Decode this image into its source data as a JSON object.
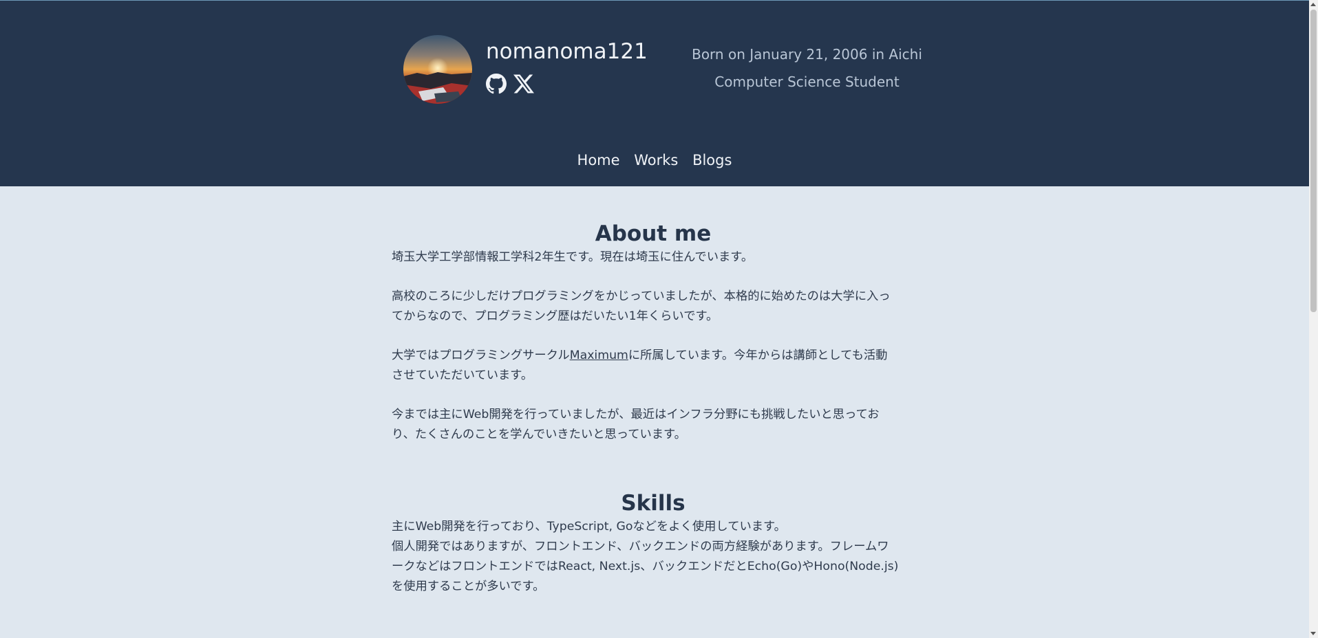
{
  "profile": {
    "name": "nomanoma121",
    "avatar_alt": "profile avatar",
    "social": [
      {
        "icon": "github-icon",
        "label": "GitHub"
      },
      {
        "icon": "x-icon",
        "label": "X"
      }
    ],
    "bio_line1": "Born on January 21, 2006 in Aichi",
    "bio_line2": "Computer Science Student"
  },
  "nav": {
    "items": [
      "Home",
      "Works",
      "Blogs"
    ]
  },
  "about": {
    "title": "About me",
    "p1": "埼玉大学工学部情報工学科2年生です。現在は埼玉に住んでいます。",
    "p2_line1": "高校のころに少しだけプログラミングをかじっていましたが、本格的に始めたのは大学に入っ",
    "p2_line2": "てからなので、プログラミング歴はだいたい1年くらいです。",
    "p3_prefix": "大学ではプログラミングサークル",
    "p3_link": "Maximum",
    "p3_suffix": "に所属しています。今年からは講師としても活動",
    "p3_line2": "させていただいています。",
    "p4_line1": "今までは主にWeb開発を行っていましたが、最近はインフラ分野にも挑戦したいと思ってお",
    "p4_line2": "り、たくさんのことを学んでいきたいと思っています。"
  },
  "skills": {
    "title": "Skills",
    "line1": "主にWeb開発を行っており、TypeScript, Goなどをよく使用しています。",
    "line2": "個人開発ではありますが、フロントエンド、バックエンドの両方経験があります。フレームワ",
    "line3": "ークなどはフロントエンドではReact, Next.js、バックエンドだとEcho(Go)やHono(Node.js)",
    "line4": "を使用することが多いです。"
  },
  "colors": {
    "header_bg": "#25364e",
    "page_bg": "#dfe7ef",
    "text": "#2f3b4d"
  }
}
